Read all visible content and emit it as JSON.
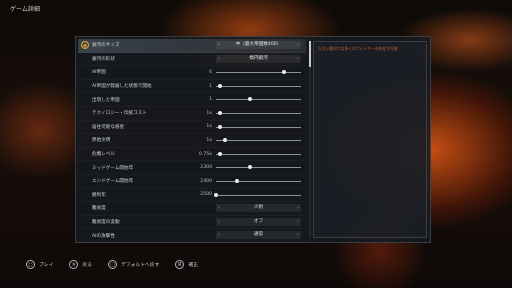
{
  "screen_title": "ゲーム詳細",
  "description": "大きい銀河では多くのプレイヤーの存在が可能",
  "rows": [
    {
      "label": "銀河のサイズ",
      "type": "choice",
      "value": "中（最大帝国数400）",
      "selected": true
    },
    {
      "label": "銀河の形状",
      "type": "choice",
      "value": "楕円銀河"
    },
    {
      "label": "AI帝国",
      "type": "slider",
      "value": "6",
      "level": 0.8
    },
    {
      "label": "AI帝国が発展した状態で開始",
      "type": "slider",
      "value": "1",
      "level": 0.05
    },
    {
      "label": "出現した帝国",
      "type": "slider",
      "value": "1",
      "level": 0.4
    },
    {
      "label": "テクノロジー・伝統コスト",
      "type": "slider",
      "value": "1x",
      "level": 0.05
    },
    {
      "label": "居住可能な惑星",
      "type": "slider",
      "value": "1x",
      "level": 0.05
    },
    {
      "label": "原始文明",
      "type": "slider",
      "value": "1x",
      "level": 0.1
    },
    {
      "label": "危機レベル",
      "type": "slider",
      "value": "0.75x",
      "level": 0.05
    },
    {
      "label": "ミッドゲーム開始年",
      "type": "slider",
      "value": "2300",
      "level": 0.4
    },
    {
      "label": "エンドゲーム開始年",
      "type": "slider",
      "value": "2400",
      "level": 0.25
    },
    {
      "label": "勝利年",
      "type": "slider",
      "value": "2500",
      "level": 0.0
    },
    {
      "label": "難易度",
      "type": "choice",
      "value": "少尉"
    },
    {
      "label": "難易度の変動",
      "type": "choice",
      "value": "オフ"
    },
    {
      "label": "AIの攻撃性",
      "type": "choice",
      "value": "通常"
    }
  ],
  "footer": [
    {
      "glyph": "○",
      "label": "プレイ",
      "icon": "circle-button-icon"
    },
    {
      "glyph": "✕",
      "label": "戻る",
      "icon": "cross-button-icon"
    },
    {
      "glyph": "□",
      "label": "デフォルトへ戻す",
      "icon": "square-button-icon"
    },
    {
      "glyph": "R",
      "label": "補正",
      "icon": "r-button-icon"
    }
  ]
}
